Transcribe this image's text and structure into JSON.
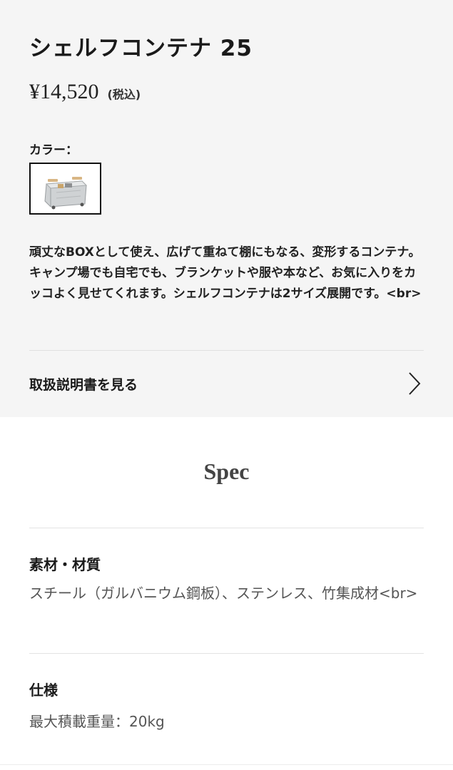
{
  "product": {
    "title": "シェルフコンテナ 25",
    "price": "¥14,520",
    "tax_note": "(税込)",
    "color_label": "カラー：",
    "description": "頑丈なBOXとして使え、広げて重ねて棚にもなる、変形するコンテナ。キャンプ場でも自宅でも、ブランケットや服や本など、お気に入りをカッコよく見せてくれます。シェルフコンテナは2サイズ展開です。<br>",
    "manual_link": "取扱説明書を見る"
  },
  "spec": {
    "heading": "Spec",
    "items": [
      {
        "title": "素材・材質",
        "value": "スチール（ガルバニウム鋼板）、ステンレス、竹集成材<br>"
      },
      {
        "title": "仕様",
        "value": "最大積載重量：20kg"
      }
    ]
  },
  "icons": {
    "swatch_image": "product-thumbnail",
    "manual_arrow": "chevron-right-icon"
  },
  "colors": {
    "top_background": "#f5f5f5",
    "text": "#1a1a1a",
    "selected_border": "#111111"
  }
}
